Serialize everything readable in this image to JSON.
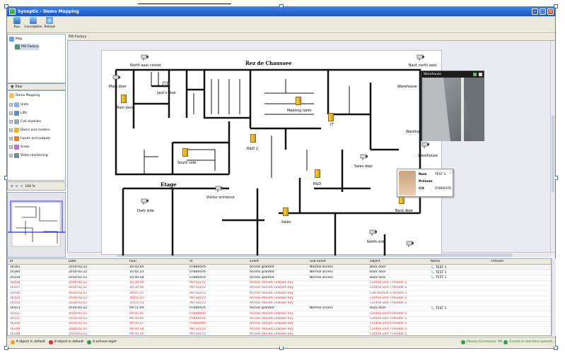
{
  "window": {
    "title": "Synoptic - Demo Mapping"
  },
  "toolbar": {
    "buttons": [
      {
        "label": "Run",
        "icon": "run-icon"
      },
      {
        "label": "Conception",
        "icon": "conception-icon"
      },
      {
        "label": "Reload",
        "icon": "reload-icon"
      }
    ]
  },
  "tree_top": {
    "root": "Map",
    "child": "POI Factory"
  },
  "filter": {
    "label": "filter"
  },
  "tree_items": [
    "Demo Mapping",
    "Units",
    "Lifts",
    "Call modules",
    "Doors and readers",
    "Inputs and outputs",
    "Areas",
    "Video monitoring"
  ],
  "zoom": {
    "level": "100 %"
  },
  "map": {
    "header": "POI Factory",
    "title_top": "Rez de Chaussee",
    "title_bottom": "Etage",
    "labels": [
      "North east corner",
      "Back north east",
      "Main door",
      "Jack's door",
      "Main door",
      "Meeting room",
      "IT",
      "Warehouse",
      "Warehouse",
      "Warehouse",
      "R&D 2",
      "South side",
      "Sales door",
      "R&D",
      "Dark side",
      "Visitor entrance",
      "Sales",
      "Back door",
      "North side"
    ]
  },
  "video": {
    "title": "Warehouse"
  },
  "person": {
    "field1": "Nom",
    "value1": "TEST 1",
    "field2": "Prénom",
    "value2": "",
    "field3": "Clé",
    "value3": "07800476"
  },
  "table": {
    "columns": [
      "Id",
      "Date",
      "hour",
      "id",
      "Event",
      "Sub event",
      "Object",
      "Name",
      "Prénom"
    ],
    "rows": [
      {
        "id": "16161",
        "date": "2010-02-22",
        "hour": "10:42:44",
        "card": "07800476",
        "event": "Access granted",
        "sub": "Normal access",
        "object": "Back door",
        "name": "TEST 1",
        "prenom": "",
        "red": false
      },
      {
        "id": "16160",
        "date": "2010-02-22",
        "hour": "10:42:33",
        "card": "07800476",
        "event": "Access granted",
        "sub": "Normal access",
        "object": "Back door",
        "name": "TEST 1",
        "prenom": "",
        "red": false
      },
      {
        "id": "16159",
        "date": "2010-02-22",
        "hour": "10:40:58",
        "card": "07800476",
        "event": "Access granted",
        "sub": "Normal access",
        "object": "Back door",
        "name": "TEST 1",
        "prenom": "",
        "red": false
      },
      {
        "id": "16158",
        "date": "2010-02-22",
        "hour": "10:34:49",
        "card": "99732272",
        "event": "Access denied: unkown key",
        "sub": "",
        "object": "Control unit 7 Reader 2",
        "name": "",
        "prenom": "",
        "red": true
      },
      {
        "id": "16157",
        "date": "2010-02-22",
        "hour": "10:34:46",
        "card": "99732272",
        "event": "Access denied: unkown key",
        "sub": "",
        "object": "Control unit 7 Reader 2",
        "name": "",
        "prenom": "",
        "red": true
      },
      {
        "id": "16156",
        "date": "2010-02-22",
        "hour": "10:07:25",
        "card": "99732272",
        "event": "Access denied: unkown key",
        "sub": "",
        "object": "Call module 1 Reader 1",
        "name": "",
        "prenom": "",
        "red": true
      },
      {
        "id": "16155",
        "date": "2010-02-22",
        "hour": "10:07:25",
        "card": "99732272",
        "event": "Access denied: unkown key",
        "sub": "",
        "object": "Control unit 7 Reader 2",
        "name": "",
        "prenom": "",
        "red": true
      },
      {
        "id": "16154",
        "date": "2010-02-22",
        "hour": "10:07:23",
        "card": "99732272",
        "event": "Access denied: unkown key",
        "sub": "",
        "object": "Control unit 7 Reader 2",
        "name": "",
        "prenom": "",
        "red": true
      },
      {
        "id": "16153",
        "date": "2010-02-22",
        "hour": "09:51:09",
        "card": "07800476",
        "event": "Access granted",
        "sub": "Normal access",
        "object": "Back door",
        "name": "TEST 1",
        "prenom": "",
        "red": false
      },
      {
        "id": "16152",
        "date": "2010-02-22",
        "hour": "09:50:42",
        "card": "07800000",
        "event": "Access denied: unkown key",
        "sub": "",
        "object": "Control unit 6 Reader 1",
        "name": "",
        "prenom": "",
        "red": true
      },
      {
        "id": "16151",
        "date": "2010-02-22",
        "hour": "09:50:40",
        "card": "07800476",
        "event": "Access denied: unkown key",
        "sub": "",
        "object": "Control unit 7 Reader 1",
        "name": "",
        "prenom": "",
        "red": true
      },
      {
        "id": "16150",
        "date": "2010-02-22",
        "hour": "09:50:37",
        "card": "07800990",
        "event": "Access denied: unkown key",
        "sub": "",
        "object": "Control unit 6 Reader 1",
        "name": "",
        "prenom": "",
        "red": true
      },
      {
        "id": "16149",
        "date": "2010-02-22",
        "hour": "09:50:18",
        "card": "99732272",
        "event": "Access denied: unkown key",
        "sub": "",
        "object": "Control unit 7 Reader 2",
        "name": "",
        "prenom": "",
        "red": true
      },
      {
        "id": "16148",
        "date": "2010-02-22",
        "hour": "09:50:16",
        "card": "99732272",
        "event": "Access denied: unkown key",
        "sub": "",
        "object": "Control unit 7 Reader 2",
        "name": "",
        "prenom": "",
        "red": true
      }
    ]
  },
  "status": {
    "left": [
      "9 object in default",
      "8 object in default",
      "0 actived objet"
    ],
    "right": [
      "Passan Connexion: OK",
      "Events in real time opened"
    ]
  },
  "colors": {
    "title_bar": "#1b55c8",
    "denied_row": "#e02020",
    "door": "#e3b52a",
    "ok": "#2ea043",
    "warn": "#e8a317"
  }
}
